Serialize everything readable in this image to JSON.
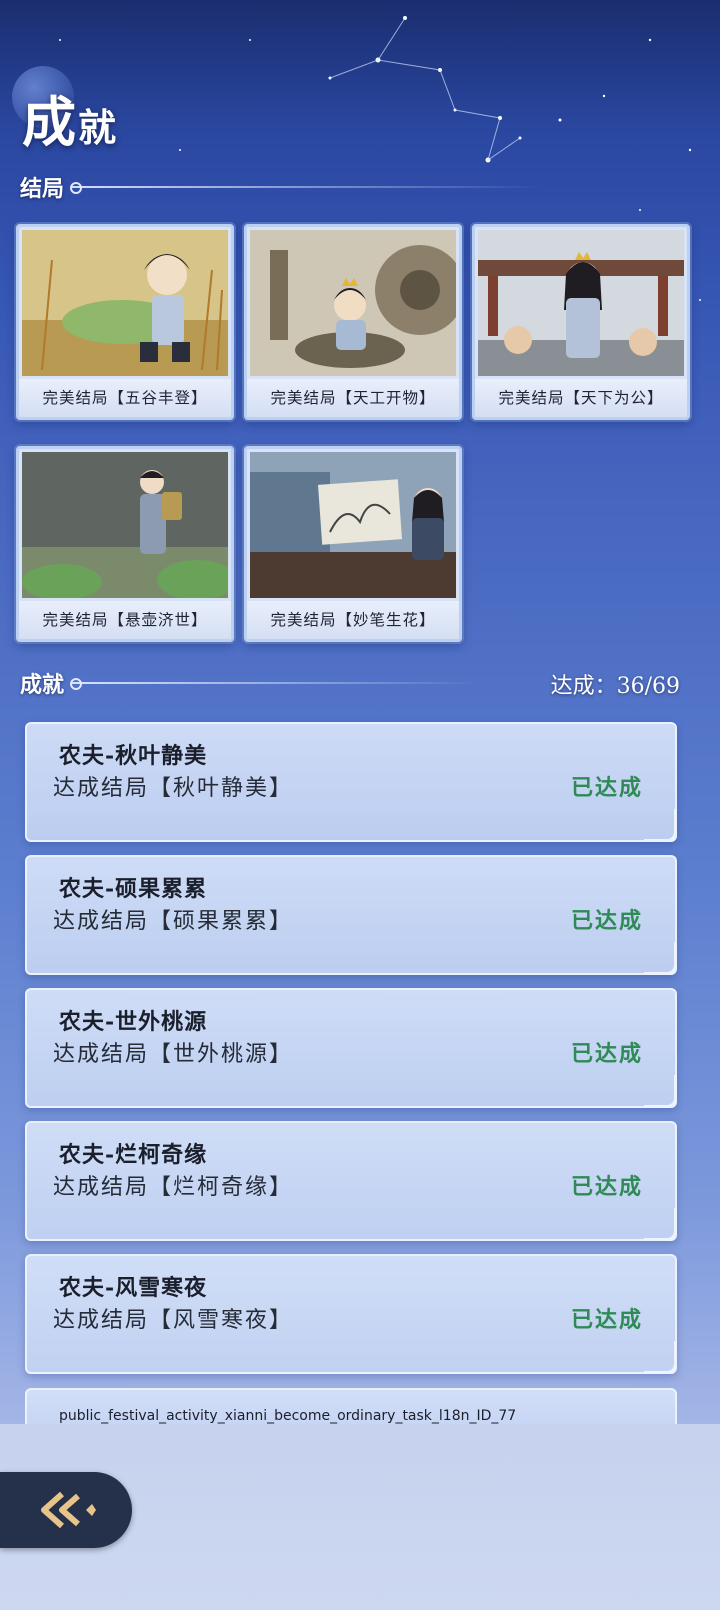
{
  "page": {
    "title_big": "成",
    "title_small": "就"
  },
  "endings_section": {
    "label": "结局"
  },
  "endings": [
    {
      "caption": "完美结局【五谷丰登】"
    },
    {
      "caption": "完美结局【天工开物】"
    },
    {
      "caption": "完美结局【天下为公】"
    },
    {
      "caption": "完美结局【悬壶济世】"
    },
    {
      "caption": "完美结局【妙笔生花】"
    }
  ],
  "achievements_section": {
    "label": "成就",
    "progress": "达成：36/69"
  },
  "achievements": [
    {
      "title": "农夫-秋叶静美",
      "desc": "达成结局【秋叶静美】",
      "status": "已达成"
    },
    {
      "title": "农夫-硕果累累",
      "desc": "达成结局【硕果累累】",
      "status": "已达成"
    },
    {
      "title": "农夫-世外桃源",
      "desc": "达成结局【世外桃源】",
      "status": "已达成"
    },
    {
      "title": "农夫-烂柯奇缘",
      "desc": "达成结局【烂柯奇缘】",
      "status": "已达成"
    },
    {
      "title": "农夫-风雪寒夜",
      "desc": "达成结局【风雪寒夜】",
      "status": "已达成"
    }
  ],
  "partial_item": {
    "text": "public_festival_activity_xianni_become_ordinary_task_l18n_ID_77"
  },
  "back_button": {
    "icon": "back-arrow-icon"
  },
  "colors": {
    "status_green": "#2f8a56",
    "back_button_bg": "#25304a"
  }
}
